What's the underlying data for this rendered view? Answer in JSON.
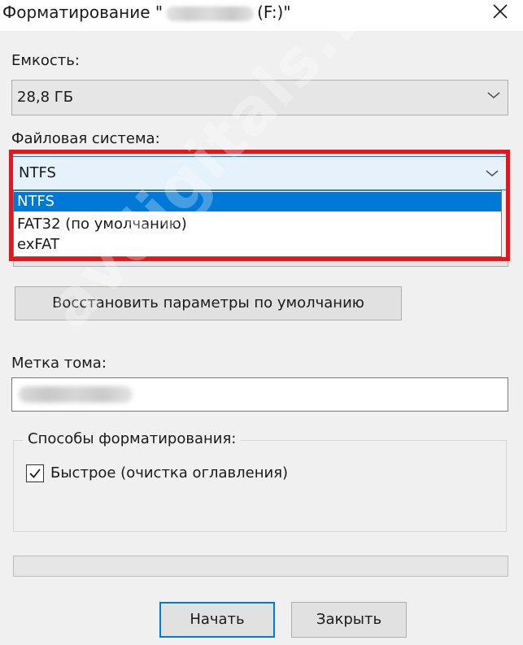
{
  "window": {
    "title_prefix": "Форматирование \"",
    "title_suffix": "(F:)\""
  },
  "capacity": {
    "label": "Емкость:",
    "value": "28,8 ГБ"
  },
  "filesystem": {
    "label": "Файловая система:",
    "value": "NTFS",
    "options": [
      "NTFS",
      "FAT32 (по умолчанию)",
      "exFAT"
    ],
    "selected_index": 0
  },
  "restore_button": "Восстановить параметры по умолчанию",
  "volume_label": {
    "label": "Метка тома:"
  },
  "format_options": {
    "group_label": "Способы форматирования:",
    "quick_label": "Быстрое (очистка оглавления)",
    "quick_checked": true
  },
  "progress": {
    "value": 0
  },
  "buttons": {
    "start": "Начать",
    "close": "Закрыть"
  },
  "watermark": "avdigitals.ru",
  "colors": {
    "accent": "#0078d7",
    "highlight": "#e8141b",
    "background": "#f0f0f0"
  },
  "icons": {
    "close": "close-icon",
    "dropdown": "chevron-down-icon",
    "check": "checkmark-icon"
  }
}
